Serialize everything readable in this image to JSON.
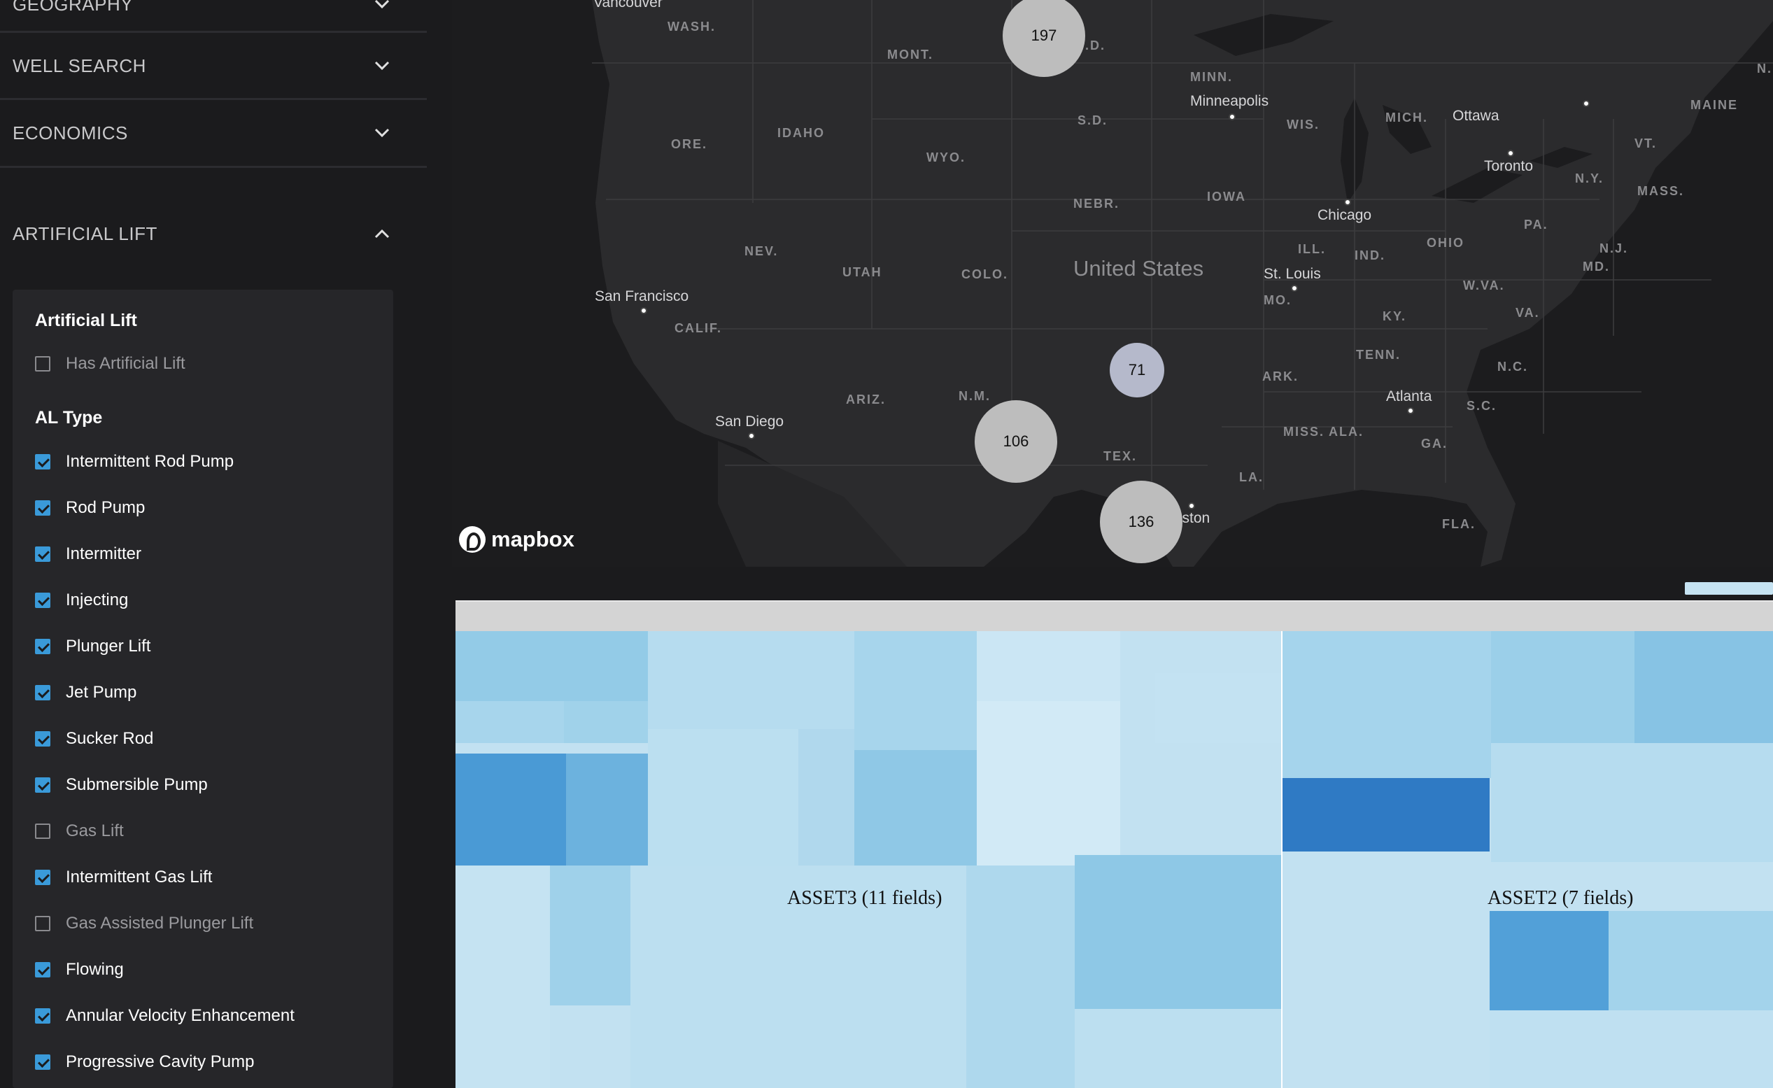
{
  "sidebar": {
    "sections": [
      {
        "label": "GEOGRAPHY",
        "expanded": false
      },
      {
        "label": "WELL SEARCH",
        "expanded": false
      },
      {
        "label": "ECONOMICS",
        "expanded": false
      },
      {
        "label": "ARTIFICIAL LIFT",
        "expanded": true
      }
    ],
    "artificial_lift": {
      "title": "Artificial Lift",
      "has_lift": {
        "label": "Has Artificial Lift",
        "checked": false
      },
      "al_type_title": "AL Type",
      "types": [
        {
          "label": "Intermittent Rod Pump",
          "checked": true
        },
        {
          "label": "Rod Pump",
          "checked": true
        },
        {
          "label": "Intermitter",
          "checked": true
        },
        {
          "label": "Injecting",
          "checked": true
        },
        {
          "label": "Plunger Lift",
          "checked": true
        },
        {
          "label": "Jet Pump",
          "checked": true
        },
        {
          "label": "Sucker Rod",
          "checked": true
        },
        {
          "label": "Submersible Pump",
          "checked": true
        },
        {
          "label": "Gas Lift",
          "checked": false
        },
        {
          "label": "Intermittent Gas Lift",
          "checked": true
        },
        {
          "label": "Gas Assisted Plunger Lift",
          "checked": false
        },
        {
          "label": "Flowing",
          "checked": true
        },
        {
          "label": "Annular Velocity Enhancement",
          "checked": true
        },
        {
          "label": "Progressive Cavity Pump",
          "checked": true
        }
      ]
    }
  },
  "map": {
    "country_label": "United States",
    "attribution": "mapbox",
    "state_labels": [
      "WASH.",
      "MONT.",
      "N.D.",
      "MINN.",
      "S.D.",
      "WIS.",
      "MICH.",
      "ORE.",
      "IDAHO",
      "WYO.",
      "NEBR.",
      "IOWA",
      "NEV.",
      "UTAH",
      "COLO.",
      "ILL.",
      "IND.",
      "OHIO",
      "PA.",
      "N.J.",
      "MD.",
      "W.VA.",
      "VA.",
      "N.Y.",
      "VT.",
      "MASS.",
      "MAINE",
      "CALIF.",
      "KY.",
      "MO.",
      "TENN.",
      "N.C.",
      "ARK.",
      "ARIZ.",
      "N.M.",
      "TEX.",
      "MISS.",
      "ALA.",
      "GA.",
      "S.C.",
      "LA.",
      "FLA.",
      "N."
    ],
    "cities": [
      "Vancouver",
      "Minneapolis",
      "Ottawa",
      "Toronto",
      "Chicago",
      "St. Louis",
      "San Francisco",
      "Atlanta",
      "San Diego",
      "Houston"
    ],
    "clusters": [
      {
        "count": "197"
      },
      {
        "count": "71"
      },
      {
        "count": "106"
      },
      {
        "count": "136"
      }
    ],
    "colors": {
      "cluster": "#bdbdbd",
      "cluster_small": "#b5b9cb",
      "land": "#2b2b2d",
      "water": "#1c1c1e"
    }
  },
  "treemap": {
    "assets": [
      {
        "label": "ASSET3 (11 fields)"
      },
      {
        "label": "ASSET2 (7 fields)"
      }
    ],
    "colors": {
      "light": "#c2e1f1",
      "mid": "#92cbe6",
      "dark": "#2f7ac4"
    }
  }
}
